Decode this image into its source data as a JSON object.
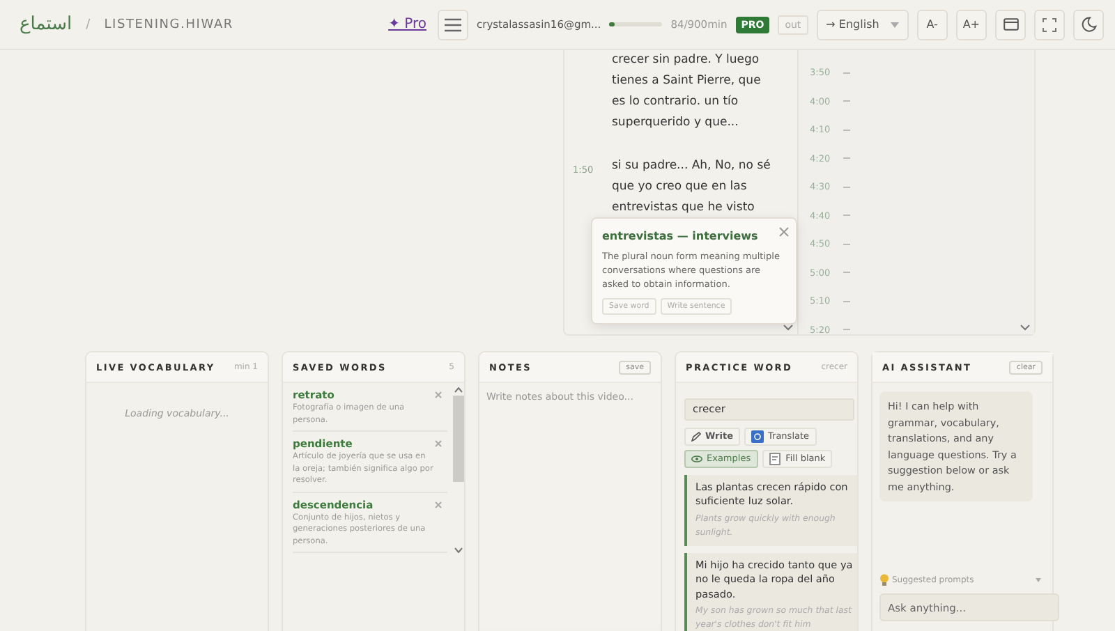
{
  "header": {
    "arabic_title": "استماع",
    "separator": "/",
    "path": "LISTENING.HIWAR",
    "pro_link": "✦ Pro",
    "email": "crystalassasin16@gm...",
    "usage": {
      "level": 0.09,
      "reading": "84/900min"
    },
    "plan_badge": "PRO",
    "logout": "out",
    "language": "→ English",
    "font_buttons": [
      "A-",
      "A+"
    ]
  },
  "transcript": [
    {
      "text": "crecer sin padre. Y luego tienes a Saint Pierre, que es lo contrario. un tío superquerido y que..."
    },
    {
      "time": "1:50",
      "text": "si su padre... Ah, No, no sé que yo creo que en las entrevistas que he visto"
    }
  ],
  "timeline": [
    "3:50",
    "4:00",
    "4:10",
    "4:20",
    "4:30",
    "4:40",
    "4:50",
    "5:00",
    "5:10",
    "5:20"
  ],
  "popup": {
    "word": "entrevistas",
    "dash": "—",
    "translation": "interviews",
    "definition": "The plural noun form meaning multiple conversations where questions are asked to obtain information.",
    "actions": [
      "Save word",
      "Write sentence"
    ]
  },
  "live_vocabulary": {
    "title": "LIVE VOCABULARY",
    "meta": "min 1",
    "status": "Loading vocabulary..."
  },
  "saved_words": {
    "title": "SAVED WORDS",
    "count": "5",
    "items": [
      {
        "word": "retrato",
        "definition": "Fotografía o imagen de una persona."
      },
      {
        "word": "pendiente",
        "definition": "Artículo de joyería que se usa en la oreja; también significa algo por resolver."
      },
      {
        "word": "descendencia",
        "definition": "Conjunto de hijos, nietos y generaciones posteriores de una persona."
      }
    ]
  },
  "notes": {
    "title": "NOTES",
    "save": "save",
    "placeholder": "Write notes about this video..."
  },
  "practice": {
    "title": "PRACTICE WORD",
    "meta": "crecer",
    "value": "crecer",
    "modes": [
      {
        "kind": "write",
        "label": "Write",
        "selected": false
      },
      {
        "kind": "translate",
        "label": "Translate",
        "selected": false
      },
      {
        "kind": "examples",
        "label": "Examples",
        "selected": true
      },
      {
        "kind": "fill",
        "label": "Fill blank",
        "selected": false
      }
    ],
    "examples": [
      {
        "text": "Las plantas crecen rápido con suficiente luz solar.",
        "translation": "Plants grow quickly with enough sunlight."
      },
      {
        "text": "Mi hijo ha crecido tanto que ya no le queda la ropa del año pasado.",
        "translation": "My son has grown so much that last year's clothes don't fit him"
      }
    ]
  },
  "assistant": {
    "title": "AI ASSISTANT",
    "clear": "clear",
    "message": "Hi! I can help with grammar, vocabulary, translations, and any language questions. Try a suggestion below or ask me anything.",
    "suggested": "Suggested prompts",
    "placeholder": "Ask anything..."
  }
}
